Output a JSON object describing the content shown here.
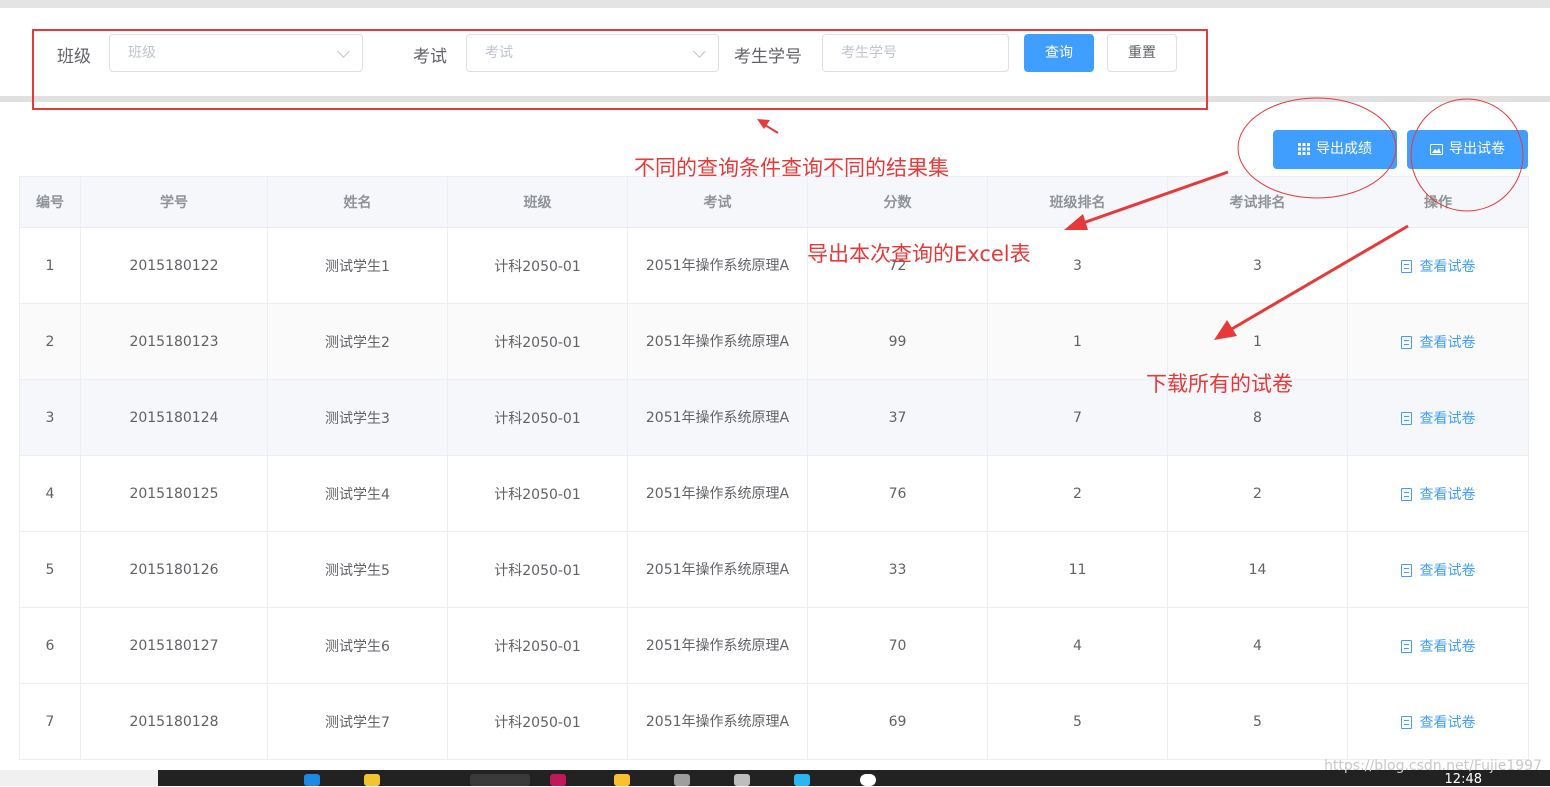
{
  "filters": {
    "class_label": "班级",
    "class_placeholder": "班级",
    "exam_label": "考试",
    "exam_placeholder": "考试",
    "student_no_label": "考生学号",
    "student_no_placeholder": "考生学号",
    "query_button": "查询",
    "reset_button": "重置"
  },
  "actions": {
    "export_scores": "导出成绩",
    "export_papers": "导出试卷"
  },
  "annotations": {
    "query_note": "不同的查询条件查询不同的结果集",
    "excel_note": "导出本次查询的Excel表",
    "download_note": "下载所有的试卷"
  },
  "table": {
    "headers": [
      "编号",
      "学号",
      "姓名",
      "班级",
      "考试",
      "分数",
      "班级排名",
      "考试排名",
      "操作"
    ],
    "view_paper": "查看试卷",
    "rows": [
      {
        "id": "1",
        "student_no": "2015180122",
        "name": "测试学生1",
        "class": "计科2050-01",
        "exam": "2051年操作系统原理A",
        "score": "72",
        "class_rank": "3",
        "exam_rank": "3"
      },
      {
        "id": "2",
        "student_no": "2015180123",
        "name": "测试学生2",
        "class": "计科2050-01",
        "exam": "2051年操作系统原理A",
        "score": "99",
        "class_rank": "1",
        "exam_rank": "1"
      },
      {
        "id": "3",
        "student_no": "2015180124",
        "name": "测试学生3",
        "class": "计科2050-01",
        "exam": "2051年操作系统原理A",
        "score": "37",
        "class_rank": "7",
        "exam_rank": "8"
      },
      {
        "id": "4",
        "student_no": "2015180125",
        "name": "测试学生4",
        "class": "计科2050-01",
        "exam": "2051年操作系统原理A",
        "score": "76",
        "class_rank": "2",
        "exam_rank": "2"
      },
      {
        "id": "5",
        "student_no": "2015180126",
        "name": "测试学生5",
        "class": "计科2050-01",
        "exam": "2051年操作系统原理A",
        "score": "33",
        "class_rank": "11",
        "exam_rank": "14"
      },
      {
        "id": "6",
        "student_no": "2015180127",
        "name": "测试学生6",
        "class": "计科2050-01",
        "exam": "2051年操作系统原理A",
        "score": "70",
        "class_rank": "4",
        "exam_rank": "4"
      },
      {
        "id": "7",
        "student_no": "2015180128",
        "name": "测试学生7",
        "class": "计科2050-01",
        "exam": "2051年操作系统原理A",
        "score": "69",
        "class_rank": "5",
        "exam_rank": "5"
      }
    ]
  },
  "taskbar": {
    "clock": "12:48"
  },
  "watermark": "https://blog.csdn.net/Fujie1997",
  "colors": {
    "primary": "#409eff",
    "annotation_red": "#e8393a"
  }
}
